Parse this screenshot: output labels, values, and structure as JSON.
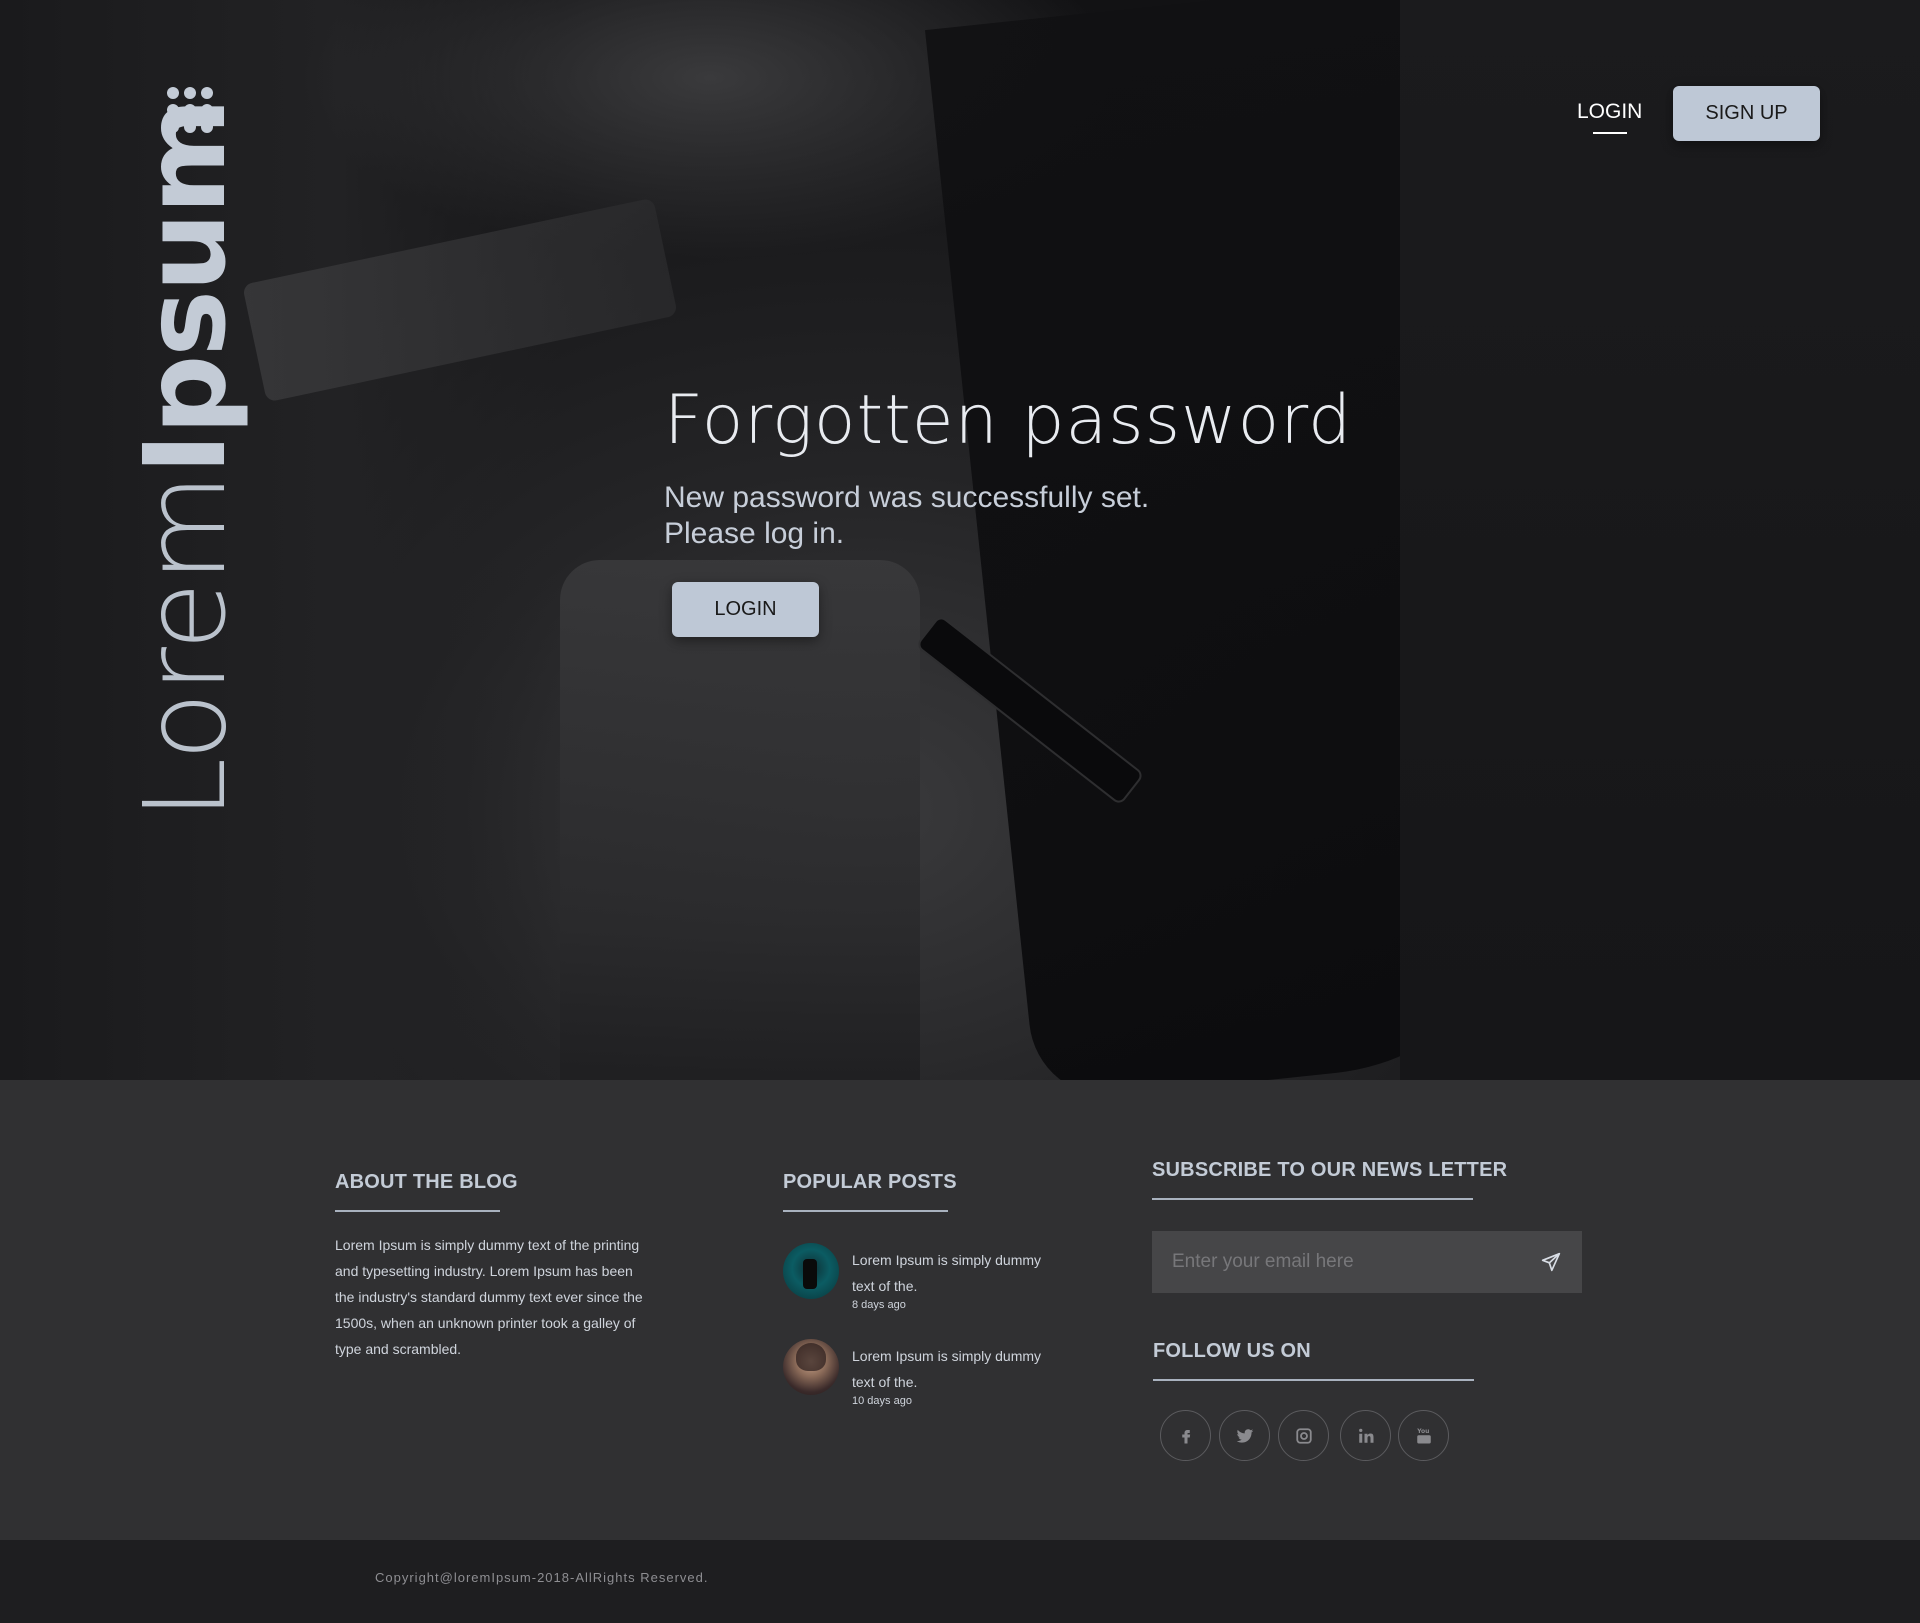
{
  "brand": {
    "light": "Lorem",
    "bold": "Ipsum"
  },
  "nav": {
    "login_label": "LOGIN",
    "signup_label": "SIGN UP"
  },
  "hero": {
    "title": "Forgotten password",
    "message_line1": "New password was successfully set.",
    "message_line2": "Please log in.",
    "login_button": "LOGIN"
  },
  "footer": {
    "about": {
      "heading": "ABOUT THE BLOG",
      "text": "Lorem Ipsum is simply dummy text of the printing and typesetting industry. Lorem Ipsum has been the industry's standard dummy text ever since the 1500s, when an unknown printer took a galley of type and scrambled."
    },
    "popular": {
      "heading": "POPULAR POSTS",
      "posts": [
        {
          "text": "Lorem Ipsum is simply dummy text of the.",
          "date": "8 days ago"
        },
        {
          "text": "Lorem Ipsum is simply dummy text of the.",
          "date": "10 days ago"
        }
      ]
    },
    "subscribe": {
      "heading": "SUBSCRIBE TO OUR NEWS LETTER",
      "placeholder": "Enter your email here"
    },
    "follow": {
      "heading": "FOLLOW US ON",
      "icons": [
        "facebook-icon",
        "twitter-icon",
        "instagram-icon",
        "linkedin-icon",
        "youtube-icon"
      ]
    },
    "copyright": "Copyright@loremIpsum-2018-AllRights Reserved."
  },
  "colors": {
    "accent": "#bec8d6",
    "footer_bg": "#303032",
    "bottom_bg": "#1e1e20"
  }
}
